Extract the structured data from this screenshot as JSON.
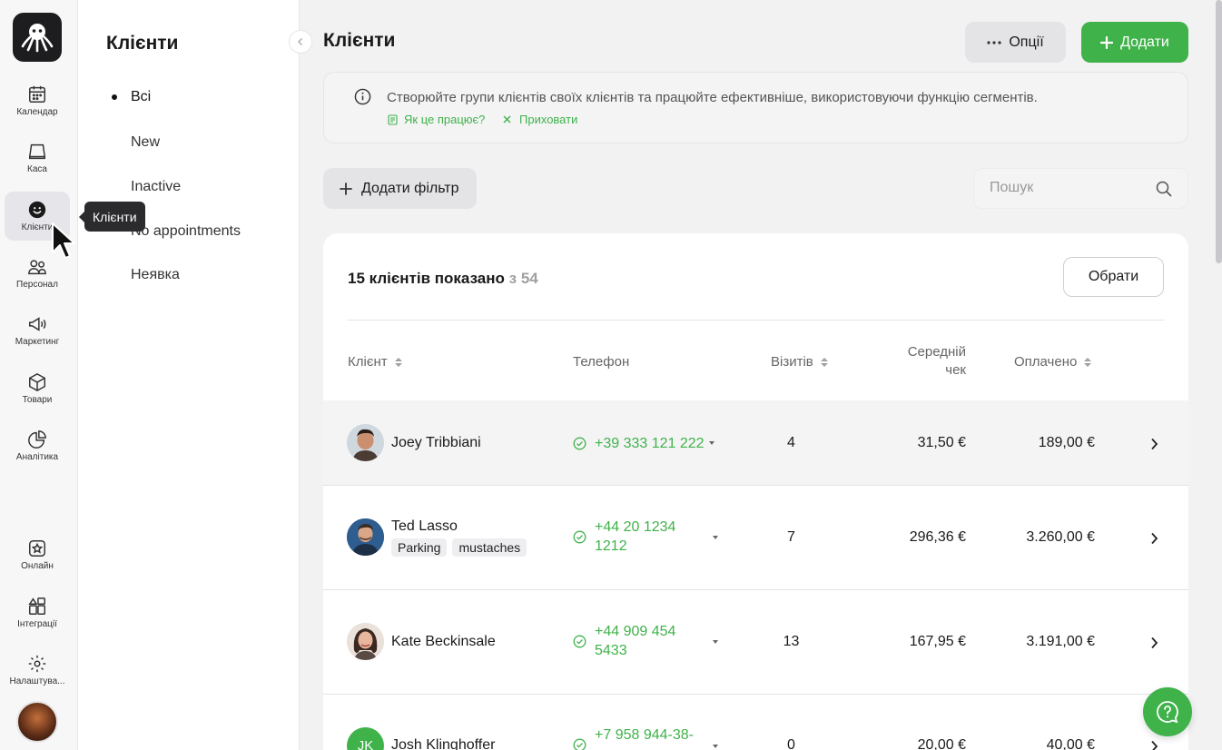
{
  "rail": {
    "items": [
      {
        "label": "Календар",
        "icon": "calendar-icon"
      },
      {
        "label": "Каса",
        "icon": "cash-register-icon"
      },
      {
        "label": "Клієнти",
        "icon": "smile-icon"
      },
      {
        "label": "Персонал",
        "icon": "staff-icon"
      },
      {
        "label": "Маркетинг",
        "icon": "megaphone-icon"
      },
      {
        "label": "Товари",
        "icon": "box-icon"
      },
      {
        "label": "Аналітика",
        "icon": "pie-chart-icon"
      },
      {
        "label": "Онлайн",
        "icon": "online-star-icon"
      },
      {
        "label": "Інтеграції",
        "icon": "integrations-icon"
      },
      {
        "label": "Налаштува...",
        "icon": "gear-icon"
      }
    ],
    "active": "Клієнти",
    "tooltip": "Клієнти"
  },
  "segments": {
    "title": "Клієнти",
    "items": [
      "Всі",
      "New",
      "Inactive",
      "No appointments",
      "Неявка"
    ],
    "selected": "Всі"
  },
  "header": {
    "title": "Клієнти",
    "options_label": "Опції",
    "add_label": "Додати"
  },
  "info": {
    "text": "Створюйте групи клієнтів своїх клієнтів та працюйте ефективніше, використовуючи функцію сегментів.",
    "how_link": "Як це працює?",
    "hide_link": "Приховати"
  },
  "toolbar": {
    "filter_label": "Додати фільтр",
    "search_placeholder": "Пошук"
  },
  "table": {
    "count_label": "15 клієнтів показано",
    "total_label": "з 54",
    "select_label": "Обрати",
    "columns": {
      "client": "Клієнт",
      "phone": "Телефон",
      "visits": "Візитів",
      "avg_check_line1": "Середній",
      "avg_check_line2": "чек",
      "paid": "Оплачено"
    },
    "rows": [
      {
        "name": "Joey Tribbiani",
        "tags": [],
        "phone_line1": "+39 333 121 222",
        "phone_line2": "",
        "visits": "4",
        "avg": "31,50 €",
        "paid": "189,00 €"
      },
      {
        "name": "Ted Lasso",
        "tags": [
          "Parking",
          "mustaches"
        ],
        "phone_line1": "+44 20 1234",
        "phone_line2": "1212",
        "visits": "7",
        "avg": "296,36 €",
        "paid": "3.260,00 €"
      },
      {
        "name": "Kate Beckinsale",
        "tags": [],
        "phone_line1": "+44 909 454",
        "phone_line2": "5433",
        "visits": "13",
        "avg": "167,95 €",
        "paid": "3.191,00 €"
      },
      {
        "name": "Josh Klinghoffer",
        "initials": "JK",
        "tags": [],
        "phone_line1": "+7 958 944-38-",
        "phone_line2": "",
        "visits": "0",
        "avg": "20,00 €",
        "paid": "40,00 €"
      }
    ]
  },
  "colors": {
    "accent": "#3fb24a",
    "muted": "#a0a0a3"
  }
}
